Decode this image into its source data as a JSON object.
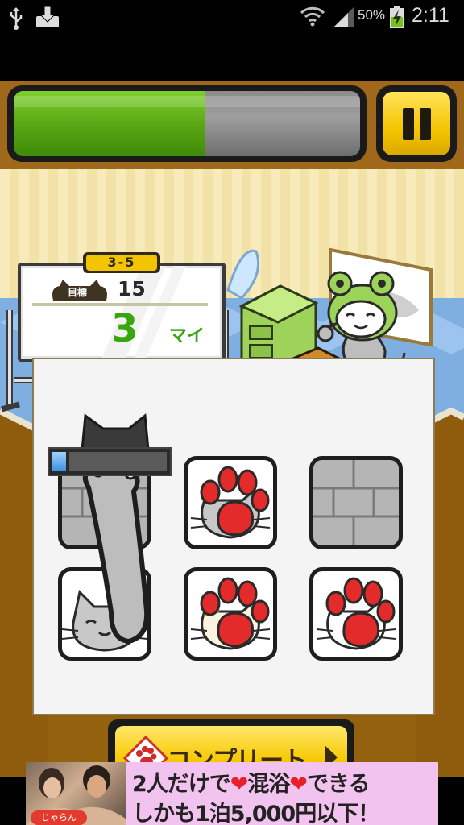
{
  "status_bar": {
    "battery_percent": "50%",
    "time": "2:11",
    "icons": [
      "usb-icon",
      "download-icon",
      "wifi-icon",
      "signal-icon",
      "battery-charging-icon"
    ]
  },
  "hud": {
    "progress_fraction": 0.55,
    "progress_colors": {
      "fill": "#5aa816",
      "empty": "#8c8c8c"
    },
    "pause_icon": "pause-icon"
  },
  "whiteboard": {
    "stage": "3-5",
    "target_label": "目標",
    "target_value": "15",
    "count_value": "3",
    "count_unit": "マイ"
  },
  "cards": [
    {
      "type": "brick",
      "covered": true
    },
    {
      "type": "paw",
      "face": "gray-cat"
    },
    {
      "type": "brick"
    },
    {
      "type": "cat-face",
      "face": "gray-cat"
    },
    {
      "type": "paw",
      "face": "calico-cat"
    },
    {
      "type": "paw",
      "face": "white-cat"
    }
  ],
  "timer_bar": {
    "fraction": 0.12
  },
  "complete_button": {
    "label": "コンプリート",
    "icon": "paw-tile-icon"
  },
  "ad": {
    "line1_a": "2人だけで",
    "line1_b": "混浴",
    "line1_c": "できる",
    "line2": "しかも1泊5,000円以下！",
    "tag": "じゃらん"
  }
}
